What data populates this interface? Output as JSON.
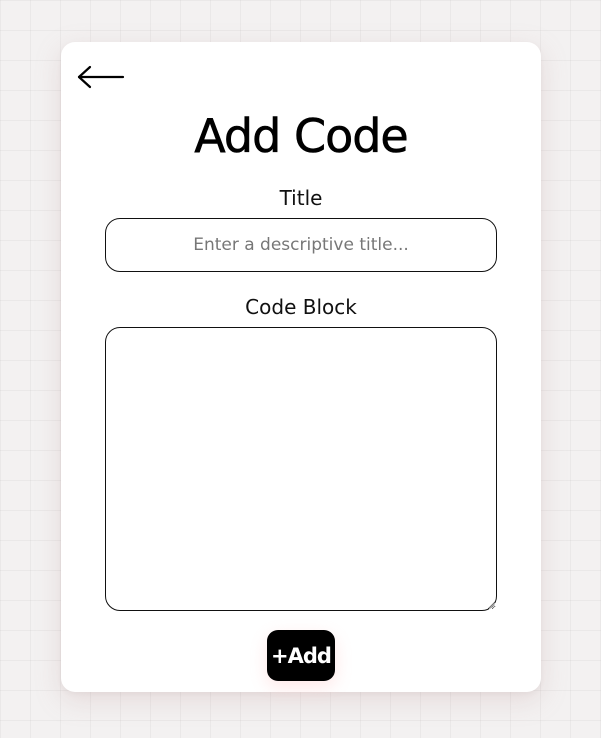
{
  "page": {
    "title": "Add Code"
  },
  "back_button": {
    "icon": "arrow-left-icon"
  },
  "form": {
    "title_label": "Title",
    "title_value": "",
    "title_placeholder": "Enter a descriptive title...",
    "code_label": "Code Block",
    "code_value": ""
  },
  "actions": {
    "add_label": "+Add"
  },
  "colors": {
    "background": "#f3f1f1",
    "card": "#ffffff",
    "button": "#000000",
    "button_text": "#ffffff"
  }
}
